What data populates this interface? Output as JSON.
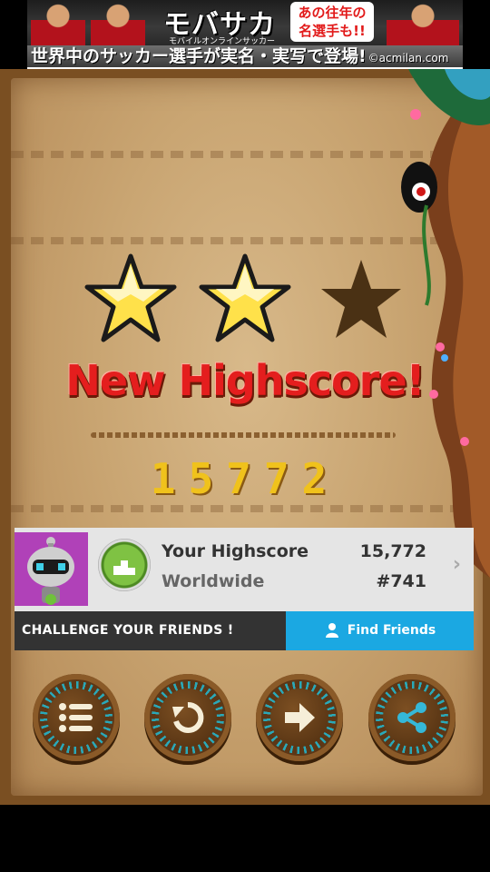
{
  "ad": {
    "brand": "モバサカ",
    "brand_sub": "モバイルオンラインサッカー",
    "badge_line1": "あの往年の",
    "badge_line2": "名選手も!!",
    "slogan": "世界中のサッカー選手が実名・実写で登場!",
    "domain": "©acmilan.com"
  },
  "result": {
    "stars_earned": 2,
    "stars_total": 3,
    "headline": "New Highscore!",
    "score": "15772"
  },
  "leaderboard": {
    "your_highscore_label": "Your Highscore",
    "your_highscore_value": "15,772",
    "worldwide_label": "Worldwide",
    "worldwide_value": "#741",
    "challenge_label": "CHALLENGE YOUR FRIENDS !",
    "find_friends_label": "Find Friends"
  },
  "buttons": [
    {
      "icon": "menu-list-icon"
    },
    {
      "icon": "replay-icon"
    },
    {
      "icon": "next-arrow-icon"
    },
    {
      "icon": "share-icon"
    }
  ],
  "colors": {
    "headline": "#e41e1e",
    "score": "#f0c21c",
    "find_friends": "#1ba8e2",
    "challenge_bar": "#333333",
    "star_filled": "#ffe14a",
    "star_empty": "#4a3114"
  }
}
